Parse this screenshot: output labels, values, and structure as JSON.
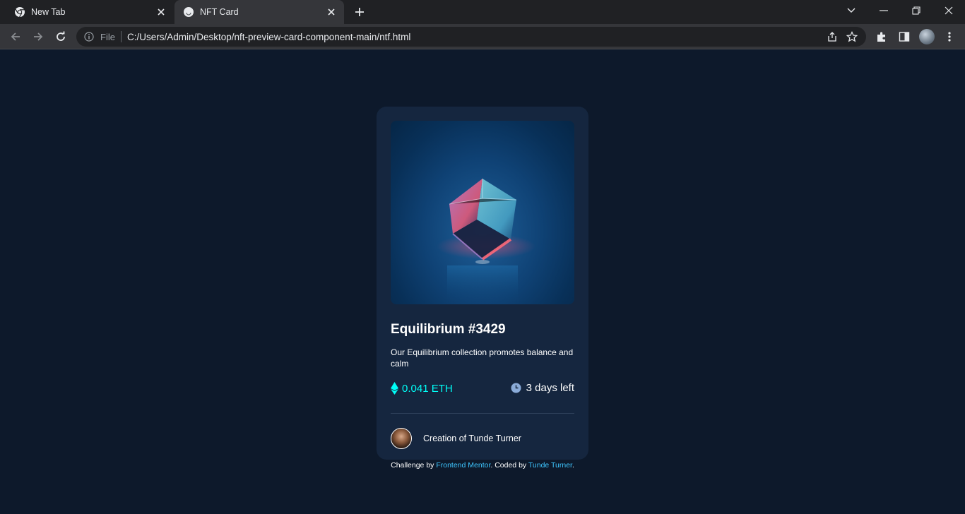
{
  "browser": {
    "tabs": [
      {
        "title": "New Tab",
        "icon": "chrome-icon",
        "active": false
      },
      {
        "title": "NFT Card",
        "icon": "page-favicon-icon",
        "active": true
      }
    ],
    "address": {
      "scheme_label": "File",
      "url": "C:/Users/Admin/Desktop/nft-preview-card-component-main/ntf.html"
    }
  },
  "card": {
    "title": "Equilibrium #3429",
    "description": "Our Equilibrium collection promotes balance and calm",
    "price": "0.041 ETH",
    "time_left": "3 days left",
    "creator": "Creation of Tunde Turner"
  },
  "attribution": {
    "prefix": "Challenge by ",
    "link1": "Frontend Mentor",
    "middle": ". Coded by ",
    "link2": "Tunde Turner",
    "suffix": "."
  },
  "colors": {
    "page_bg": "#0d192b",
    "card_bg": "#15263f",
    "accent": "#00fff8",
    "link": "#3ec6ff"
  }
}
